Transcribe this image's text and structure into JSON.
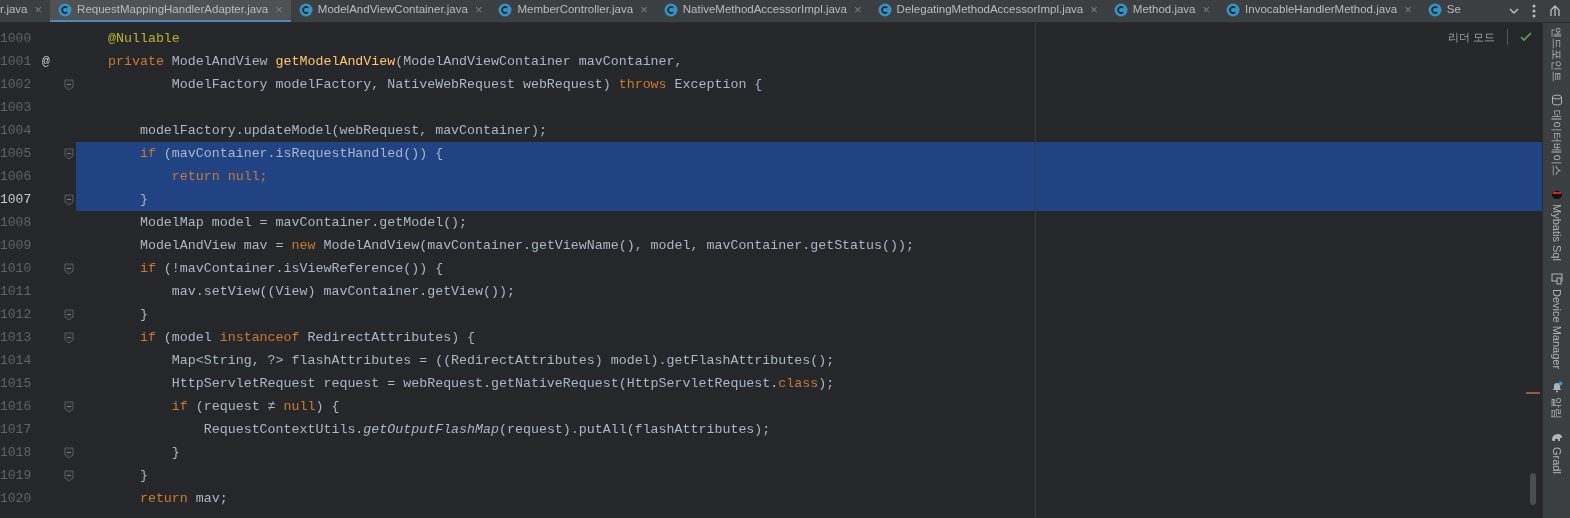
{
  "tabs": [
    {
      "label": "r.java",
      "close": "×",
      "selected": false,
      "icon": false
    },
    {
      "label": "RequestMappingHandlerAdapter.java",
      "close": "×",
      "selected": true,
      "icon": true
    },
    {
      "label": "ModelAndViewContainer.java",
      "close": "×",
      "selected": false,
      "icon": true
    },
    {
      "label": "MemberController.java",
      "close": "×",
      "selected": false,
      "icon": true
    },
    {
      "label": "NativeMethodAccessorImpl.java",
      "close": "×",
      "selected": false,
      "icon": true
    },
    {
      "label": "DelegatingMethodAccessorImpl.java",
      "close": "×",
      "selected": false,
      "icon": true
    },
    {
      "label": "Method.java",
      "close": "×",
      "selected": false,
      "icon": true
    },
    {
      "label": "InvocableHandlerMethod.java",
      "close": "×",
      "selected": false,
      "icon": true
    },
    {
      "label": "Se",
      "selected": false,
      "icon": true
    }
  ],
  "reader_mode": "리더 모드",
  "lines": [
    {
      "number": "1000",
      "fold": false,
      "selected": false,
      "current": false,
      "tokens": [
        {
          "text": "@Nullable",
          "kind": "annotation"
        }
      ]
    },
    {
      "number": "1001",
      "marker": "@",
      "fold": false,
      "selected": false,
      "current": false,
      "tokens": [
        {
          "text": "private ",
          "kind": "keyword"
        },
        {
          "text": "ModelAndView ",
          "kind": "plain"
        },
        {
          "text": "getModelAndView",
          "kind": "declaration"
        },
        {
          "text": "(ModelAndViewContainer mavContainer,",
          "kind": "plain"
        }
      ]
    },
    {
      "number": "1002",
      "fold": true,
      "selected": false,
      "current": false,
      "tokens": [
        {
          "text": "        ModelFactory modelFactory, NativeWebRequest webRequest) ",
          "kind": "plain"
        },
        {
          "text": "throws ",
          "kind": "keyword"
        },
        {
          "text": "Exception {",
          "kind": "plain"
        }
      ]
    },
    {
      "number": "1003",
      "fold": false,
      "selected": false,
      "current": false
    },
    {
      "number": "1004",
      "fold": false,
      "selected": false,
      "current": false,
      "tokens": [
        {
          "text": "    modelFactory.updateModel(webRequest, mavContainer);",
          "kind": "plain"
        }
      ]
    },
    {
      "number": "1005",
      "fold": true,
      "selected": true,
      "current": false,
      "tokens": [
        {
          "text": "    if ",
          "kind": "keyword"
        },
        {
          "text": "(mavContainer.isRequestHandled()) {",
          "kind": "plain"
        }
      ]
    },
    {
      "number": "1006",
      "fold": false,
      "selected": true,
      "current": false,
      "tokens": [
        {
          "text": "        return null;",
          "kind": "keyword"
        }
      ]
    },
    {
      "number": "1007",
      "fold": true,
      "selected": true,
      "current": true,
      "tokens": [
        {
          "text": "    }",
          "kind": "plain"
        }
      ]
    },
    {
      "number": "1008",
      "fold": false,
      "selected": false,
      "current": false,
      "tokens": [
        {
          "text": "    ModelMap model = mavContainer.getModel();",
          "kind": "plain"
        }
      ]
    },
    {
      "number": "1009",
      "fold": false,
      "selected": false,
      "current": false,
      "tokens": [
        {
          "text": "    ModelAndView mav = ",
          "kind": "plain"
        },
        {
          "text": "new ",
          "kind": "keyword"
        },
        {
          "text": "ModelAndView(mavContainer.getViewName(), model, mavContainer.getStatus());",
          "kind": "plain"
        }
      ]
    },
    {
      "number": "1010",
      "fold": true,
      "selected": false,
      "current": false,
      "tokens": [
        {
          "text": "    if ",
          "kind": "keyword"
        },
        {
          "text": "(!mavContainer.isViewReference()) {",
          "kind": "plain"
        }
      ]
    },
    {
      "number": "1011",
      "fold": false,
      "selected": false,
      "current": false,
      "tokens": [
        {
          "text": "        mav.setView((View) mavContainer.getView());",
          "kind": "plain"
        }
      ]
    },
    {
      "number": "1012",
      "fold": true,
      "selected": false,
      "current": false,
      "tokens": [
        {
          "text": "    }",
          "kind": "plain"
        }
      ]
    },
    {
      "number": "1013",
      "fold": true,
      "selected": false,
      "current": false,
      "tokens": [
        {
          "text": "    if ",
          "kind": "keyword"
        },
        {
          "text": "(model ",
          "kind": "plain"
        },
        {
          "text": "instanceof ",
          "kind": "keyword"
        },
        {
          "text": "RedirectAttributes) {",
          "kind": "plain"
        }
      ]
    },
    {
      "number": "1014",
      "fold": false,
      "selected": false,
      "current": false,
      "tokens": [
        {
          "text": "        Map<String, ?> flashAttributes = ((RedirectAttributes) model).getFlashAttributes();",
          "kind": "plain"
        }
      ]
    },
    {
      "number": "1015",
      "fold": false,
      "selected": false,
      "current": false,
      "tokens": [
        {
          "text": "        HttpServletRequest request = webRequest.getNativeRequest(HttpServletRequest.",
          "kind": "plain"
        },
        {
          "text": "class",
          "kind": "keyword"
        },
        {
          "text": ");",
          "kind": "plain"
        }
      ]
    },
    {
      "number": "1016",
      "fold": true,
      "selected": false,
      "current": false,
      "tokens": [
        {
          "text": "        if ",
          "kind": "keyword"
        },
        {
          "text": "(request ≠ ",
          "kind": "plain"
        },
        {
          "text": "null",
          "kind": "keyword"
        },
        {
          "text": ") {",
          "kind": "plain"
        }
      ]
    },
    {
      "number": "1017",
      "fold": false,
      "selected": false,
      "current": false,
      "tokens": [
        {
          "text": "            RequestContextUtils.",
          "kind": "plain"
        },
        {
          "text": "getOutputFlashMap",
          "kind": "static"
        },
        {
          "text": "(request).putAll(flashAttributes);",
          "kind": "plain"
        }
      ]
    },
    {
      "number": "1018",
      "fold": true,
      "selected": false,
      "current": false,
      "tokens": [
        {
          "text": "        }",
          "kind": "plain"
        }
      ]
    },
    {
      "number": "1019",
      "fold": true,
      "selected": false,
      "current": false,
      "tokens": [
        {
          "text": "    }",
          "kind": "plain"
        }
      ]
    },
    {
      "number": "1020",
      "fold": false,
      "selected": false,
      "current": false,
      "tokens": [
        {
          "text": "    return ",
          "kind": "keyword"
        },
        {
          "text": "mav;",
          "kind": "plain"
        }
      ]
    }
  ],
  "side_tools": [
    {
      "label": "엔드포인트",
      "kind": "endpoints"
    },
    {
      "label": "데이터베이스",
      "kind": "database"
    },
    {
      "label": "Mybatis Sql",
      "kind": "mybatis"
    },
    {
      "label": "Device Manager",
      "kind": "device"
    },
    {
      "label": "알림",
      "kind": "notifications"
    },
    {
      "label": "Gradl",
      "kind": "gradle"
    }
  ]
}
